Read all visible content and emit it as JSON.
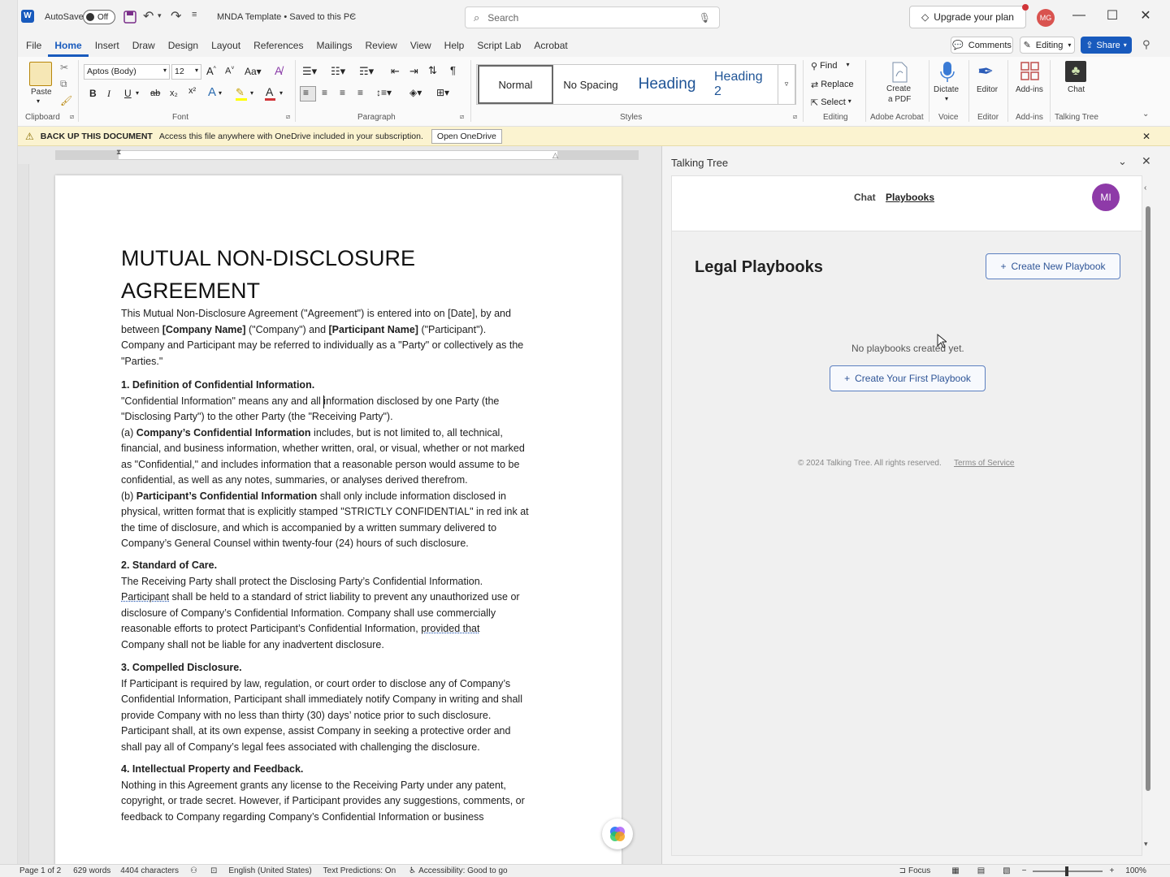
{
  "titlebar": {
    "autosave_label": "AutoSave",
    "autosave_state": "Off",
    "doc_title": "MNDA Template • Saved to this PC",
    "search_placeholder": "Search",
    "upgrade_label": "Upgrade your plan",
    "user_initials": "MG"
  },
  "menu": {
    "tabs": [
      "File",
      "Home",
      "Insert",
      "Draw",
      "Design",
      "Layout",
      "References",
      "Mailings",
      "Review",
      "View",
      "Help",
      "Script Lab",
      "Acrobat"
    ],
    "comments_label": "Comments",
    "editing_label": "Editing",
    "share_label": "Share"
  },
  "ribbon": {
    "paste_label": "Paste",
    "clipboard_label": "Clipboard",
    "font_name": "Aptos (Body)",
    "font_size": "12",
    "font_label": "Font",
    "paragraph_label": "Paragraph",
    "styles_label": "Styles",
    "styles": [
      "Normal",
      "No Spacing",
      "Heading",
      "Heading 2"
    ],
    "find_label": "Find",
    "replace_label": "Replace",
    "select_label": "Select",
    "editing_group_label": "Editing",
    "create_pdf_label_1": "Create",
    "create_pdf_label_2": "a PDF",
    "adobe_label": "Adobe Acrobat",
    "dictate_label": "Dictate",
    "voice_label": "Voice",
    "editor_label": "Editor",
    "editor_group_label": "Editor",
    "addins_label": "Add-ins",
    "addins_group_label": "Add-ins",
    "chat_label": "Chat",
    "talking_tree_group_label": "Talking Tree",
    "bold": "B",
    "italic": "I",
    "underline": "U"
  },
  "infobar": {
    "title": "BACK UP THIS DOCUMENT",
    "message": "Access this file anywhere with OneDrive included in your subscription.",
    "button": "Open OneDrive"
  },
  "document": {
    "title_line1": "MUTUAL NON-DISCLOSURE",
    "title_line2": "AGREEMENT",
    "intro_1": "This Mutual Non-Disclosure Agreement (\"Agreement\") is entered into on [Date], by and",
    "intro_2a": "between ",
    "intro_2b": "[Company Name]",
    "intro_2c": " (\"Company\") and ",
    "intro_2d": "[Participant Name]",
    "intro_2e": " (\"Participant\").",
    "intro_3": "Company and Participant may be referred to individually as a \"Party\" or collectively as the",
    "intro_4": "\"Parties.\"",
    "s1_heading": "1. Definition of Confidential Information.",
    "s1_l1": "\"Confidential Information\" means any and all information disclosed by one Party (the",
    "s1_l2": "\"Disclosing Party\") to the other Party (the \"Receiving Party\").",
    "s1_l3a": "(a) ",
    "s1_l3b": "Company’s Confidential Information",
    "s1_l3c": " includes, but is not limited to, all technical,",
    "s1_l4": "financial, and business information, whether written, oral, or visual, whether or not marked",
    "s1_l5": "as \"Confidential,\" and includes information that a reasonable person would assume to be",
    "s1_l6": "confidential, as well as any notes, summaries, or analyses derived therefrom.",
    "s1_l7a": "(b) ",
    "s1_l7b": "Participant’s Confidential Information",
    "s1_l7c": " shall only include information disclosed in",
    "s1_l8": "physical, written format that is explicitly stamped \"STRICTLY CONFIDENTIAL\" in red ink at",
    "s1_l9": "the time of disclosure, and which is accompanied by a written summary delivered to",
    "s1_l10": "Company’s General Counsel within twenty-four (24) hours of such disclosure.",
    "s2_heading": "2. Standard of Care.",
    "s2_l1": "The Receiving Party shall protect the Disclosing Party’s Confidential Information.",
    "s2_l2a": "Participant",
    "s2_l2b": " shall be held to a standard of strict liability to prevent any unauthorized use or",
    "s2_l3": "disclosure of Company’s Confidential Information. Company shall use commercially",
    "s2_l4a": "reasonable efforts to protect Participant’s Confidential Information, ",
    "s2_l4b": "provided that",
    "s2_l5": "Company shall not be liable for any inadvertent disclosure.",
    "s3_heading": "3. Compelled Disclosure.",
    "s3_l1": "If Participant is required by law, regulation, or court order to disclose any of Company’s",
    "s3_l2": "Confidential Information, Participant shall immediately notify Company in writing and shall",
    "s3_l3": "provide Company with no less than thirty (30) days’ notice prior to such disclosure.",
    "s3_l4": "Participant shall, at its own expense, assist Company in seeking a protective order and",
    "s3_l5": "shall pay all of Company’s legal fees associated with challenging the disclosure.",
    "s4_heading": "4. Intellectual Property and Feedback.",
    "s4_l1": "Nothing in this Agreement grants any license to the Receiving Party under any patent,",
    "s4_l2": "copyright, or trade secret. However, if Participant provides any suggestions, comments, or",
    "s4_l3": "feedback to Company regarding Company’s Confidential Information or business"
  },
  "pane": {
    "title": "Talking Tree",
    "tab_chat": "Chat",
    "tab_playbooks": "Playbooks",
    "avatar_initials": "MI",
    "heading": "Legal Playbooks",
    "create_new": "Create New Playbook",
    "empty_text": "No playbooks created yet.",
    "create_first": "Create Your First Playbook",
    "footer_copy": "© 2024 Talking Tree. All rights reserved.",
    "footer_link": "Terms of Service"
  },
  "status": {
    "page": "Page 1 of 2",
    "words": "629 words",
    "characters": "4404 characters",
    "language": "English (United States)",
    "predictions": "Text Predictions: On",
    "accessibility": "Accessibility: Good to go",
    "focus": "Focus",
    "zoom": "100%"
  },
  "colors": {
    "accent": "#185abd",
    "pane_button_border": "#5b7fc0",
    "avatar_mi": "#8e3aa8",
    "avatar_mg": "#d9534f",
    "infobar_bg": "#fbf3d0"
  }
}
